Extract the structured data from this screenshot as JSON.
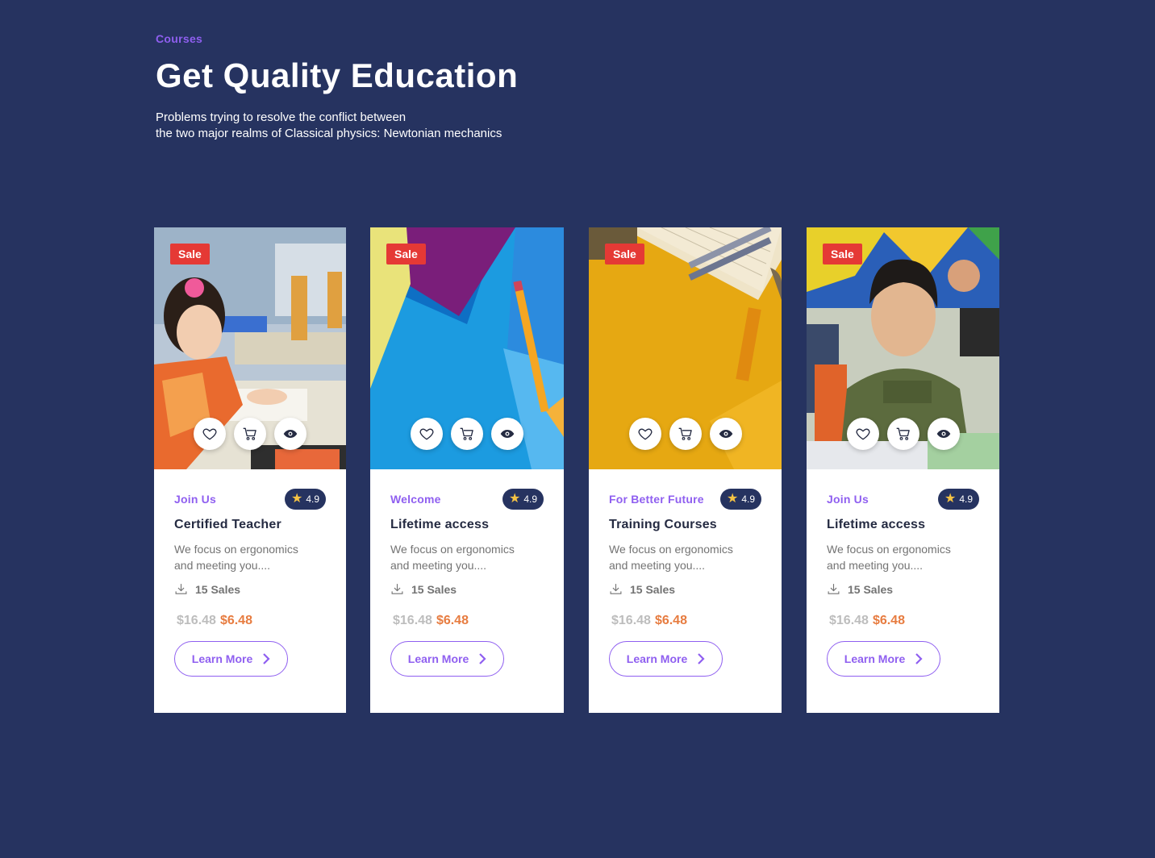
{
  "header": {
    "eyebrow": "Courses",
    "title": "Get Quality Education",
    "subtitle_line1": "Problems trying to resolve the conflict between",
    "subtitle_line2": "the two major realms of Classical physics: Newtonian mechanics"
  },
  "colors": {
    "background": "#263360",
    "accent": "#8F5FF0",
    "sale": "#E53935",
    "price": "#E77C40",
    "star": "#F6C344"
  },
  "cards": [
    {
      "badge": "Sale",
      "category": "Join Us",
      "rating": "4.9",
      "title": "Certified Teacher",
      "desc_line1": "We focus on ergonomics",
      "desc_line2": "and meeting you....",
      "sales": "15 Sales",
      "old_price": "$16.48",
      "new_price": "$6.48",
      "cta": "Learn More"
    },
    {
      "badge": "Sale",
      "category": "Welcome",
      "rating": "4.9",
      "title": "Lifetime access",
      "desc_line1": "We focus on ergonomics",
      "desc_line2": "and meeting you....",
      "sales": "15 Sales",
      "old_price": "$16.48",
      "new_price": "$6.48",
      "cta": "Learn More"
    },
    {
      "badge": "Sale",
      "category": "For Better Future",
      "rating": "4.9",
      "title": "Training Courses",
      "desc_line1": "We focus on ergonomics",
      "desc_line2": "and meeting you....",
      "sales": "15 Sales",
      "old_price": "$16.48",
      "new_price": "$6.48",
      "cta": "Learn More"
    },
    {
      "badge": "Sale",
      "category": "Join Us",
      "rating": "4.9",
      "title": "Lifetime access",
      "desc_line1": "We focus on ergonomics",
      "desc_line2": "and meeting you....",
      "sales": "15 Sales",
      "old_price": "$16.48",
      "new_price": "$6.48",
      "cta": "Learn More"
    }
  ]
}
